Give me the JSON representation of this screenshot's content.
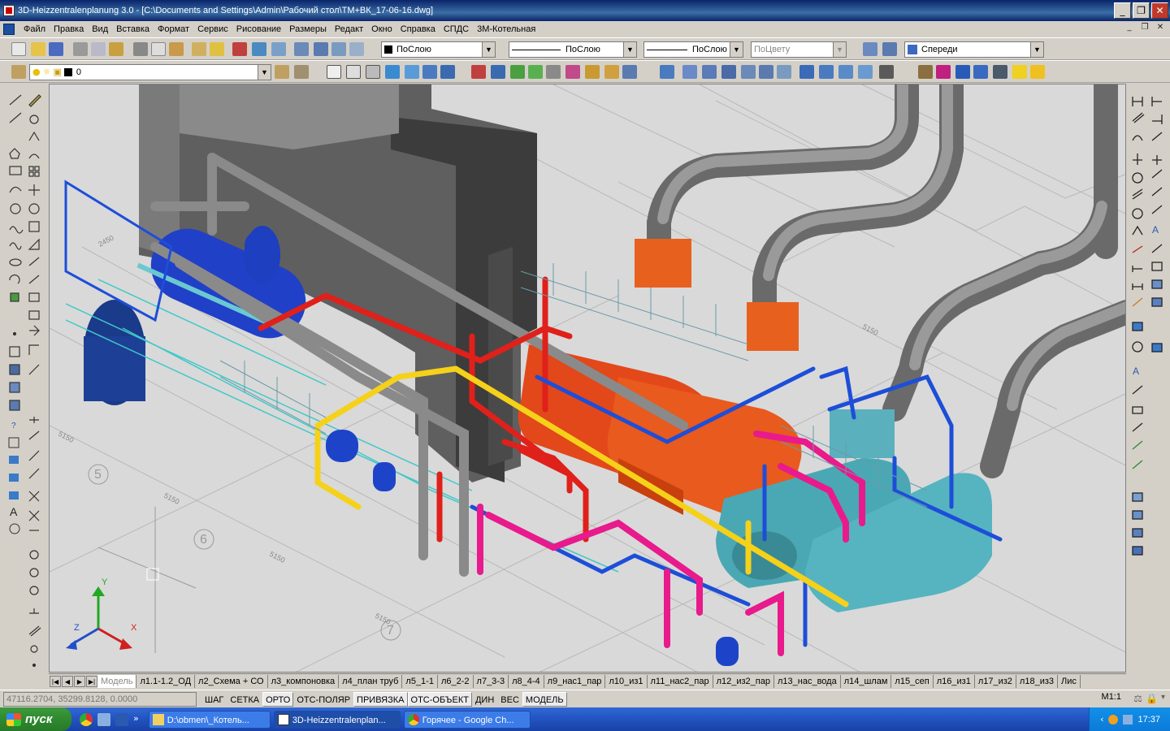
{
  "window": {
    "title": "3D-Heizzentralenplanung 3.0 - [C:\\Documents and Settings\\Admin\\Рабочий стол\\ТМ+ВК_17-06-16.dwg]",
    "controls": [
      "_",
      "❐",
      "✕"
    ]
  },
  "menu": {
    "items": [
      "Файл",
      "Правка",
      "Вид",
      "Вставка",
      "Формат",
      "Сервис",
      "Рисование",
      "Размеры",
      "Редакт",
      "Окно",
      "Справка",
      "СПДС",
      "3М-Котельная"
    ]
  },
  "toolbar": {
    "linetype_combo": "ПоСлою",
    "lineweight_combo": "ПоСлою",
    "linestyle_combo": "ПоСлою",
    "plotstyle_combo": "ПоЦвету",
    "view_combo": "Спереди",
    "layer_combo": "0"
  },
  "tabs": {
    "items": [
      "Модель",
      "л1.1-1.2_ОД",
      "л2_Схема + СО",
      "л3_компоновка",
      "л4_план труб",
      "л5_1-1",
      "л6_2-2",
      "л7_3-3",
      "л8_4-4",
      "л9_нас1_пар",
      "л10_из1",
      "л11_нас2_пар",
      "л12_из2_пар",
      "л13_нас_вода",
      "л14_шлам",
      "л15_сеп",
      "л16_из1",
      "л17_из2",
      "л18_из3",
      "Лис"
    ]
  },
  "status": {
    "coords": "47116.2704, 35299.8128, 0.0000",
    "toggles": [
      "ШАГ",
      "СЕТКА",
      "ОРТО",
      "ОТС-ПОЛЯР",
      "ПРИВЯЗКА",
      "ОТС-ОБЪЕКТ",
      "ДИН",
      "ВЕС",
      "МОДЕЛЬ"
    ],
    "scale": "M1:1"
  },
  "taskbar": {
    "start": "пуск",
    "tasks": [
      "D:\\obmen\\_Котель...",
      "3D-Heizzentralenplan...",
      "Горячее - Google Ch..."
    ],
    "clock": "17:37"
  },
  "ucs": {
    "x": "X",
    "y": "Y",
    "z": "Z"
  },
  "dimension_labels": [
    "2450",
    "5150",
    "5150",
    "5150",
    "5150",
    "5150"
  ],
  "axis_markers": [
    "5",
    "6",
    "7"
  ],
  "colors": {
    "pipe_red": "#e0201a",
    "pipe_blue": "#1d4ed8",
    "pipe_yellow": "#f5d11a",
    "pipe_magenta": "#e81a8c",
    "pipe_grey": "#8a8a8a",
    "boiler_orange": "#e8501a",
    "boiler_teal": "#4aa8b4",
    "wall_grey": "#5c5c5c",
    "canvas_bg": "#d9d9d9"
  }
}
